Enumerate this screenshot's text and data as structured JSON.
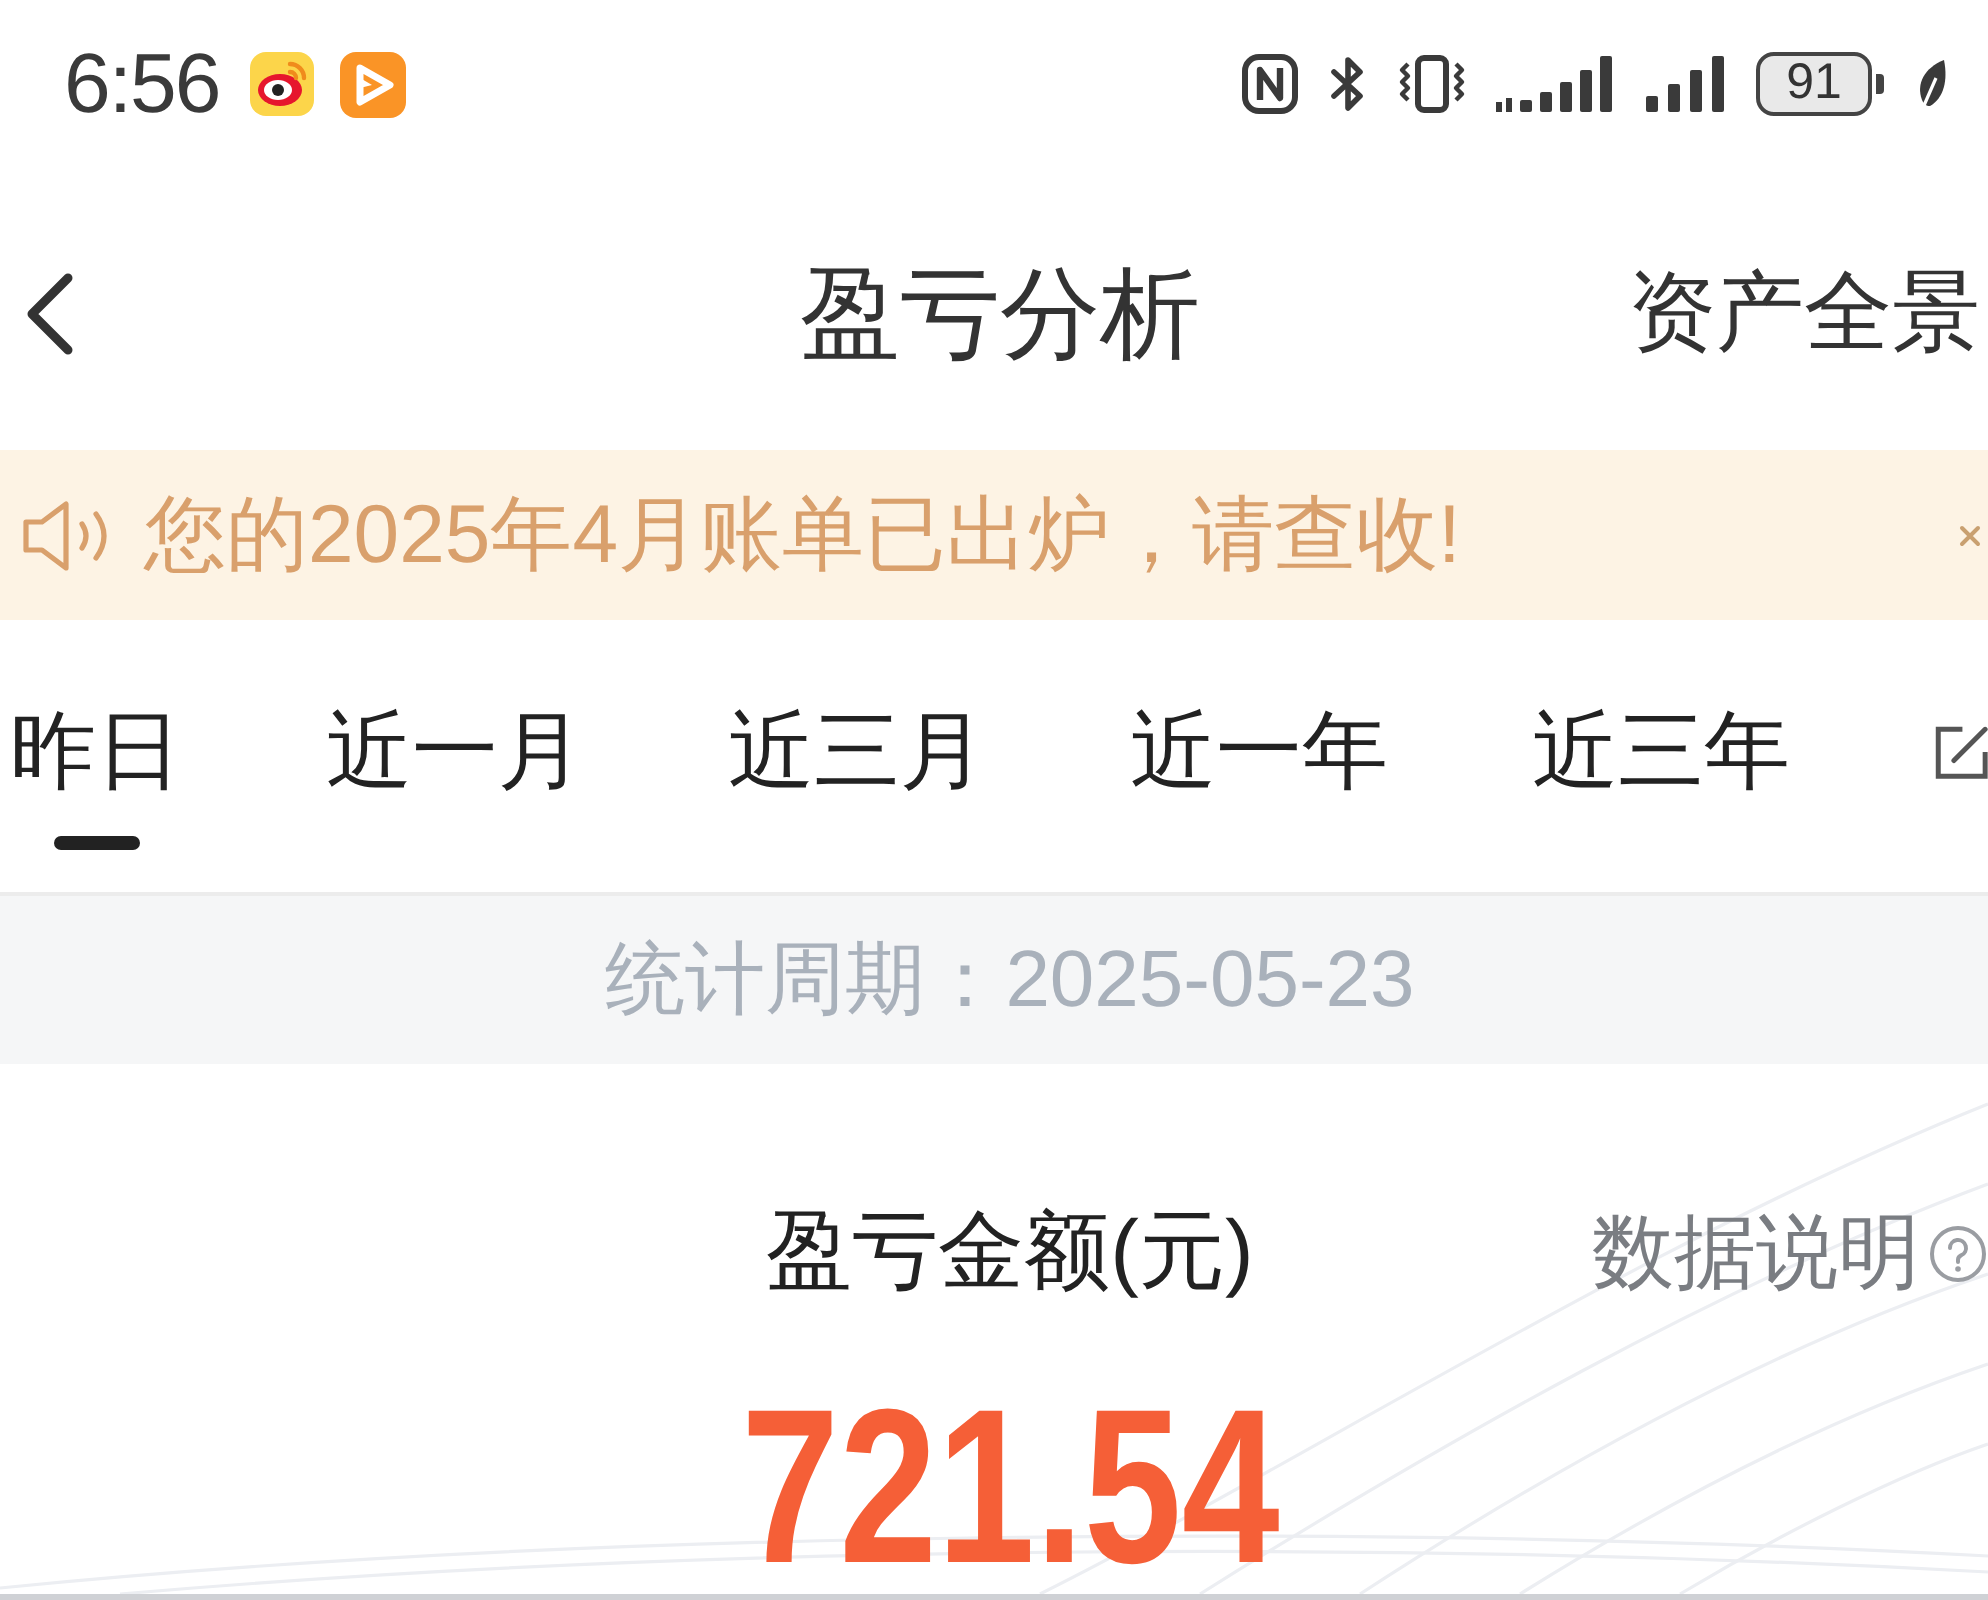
{
  "status_bar": {
    "time": "6:56",
    "battery": "91"
  },
  "nav_bar": {
    "title": "盈亏分析",
    "action": "资产全景"
  },
  "notice": {
    "text": "您的2025年4月账单已出炉，请查收!"
  },
  "period_tabs": [
    {
      "label": "昨日",
      "selected": true
    },
    {
      "label": "近一月",
      "selected": false
    },
    {
      "label": "近三月",
      "selected": false
    },
    {
      "label": "近一年",
      "selected": false
    },
    {
      "label": "近三年",
      "selected": false
    }
  ],
  "period": {
    "text": "统计周期：2025-05-23"
  },
  "summary": {
    "label": "盈亏金额(元)",
    "help_link": "数据说明",
    "amount": "721.54"
  }
}
